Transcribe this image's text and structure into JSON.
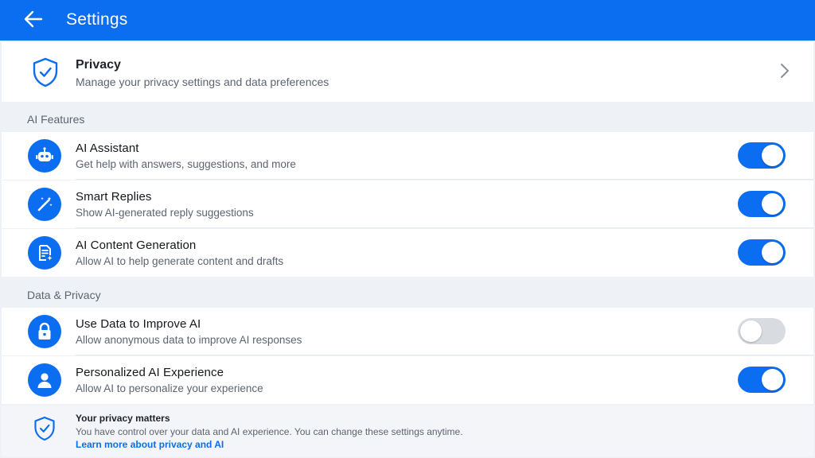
{
  "header": {
    "title": "Settings",
    "back_icon": "arrow-left-icon"
  },
  "privacy_card": {
    "icon": "shield-check-icon",
    "title": "Privacy",
    "subtitle": "Manage your privacy settings and data preferences",
    "chevron_icon": "chevron-right-icon"
  },
  "sections": {
    "ai_features": {
      "label": "AI Features",
      "items": [
        {
          "icon": "robot-icon",
          "title": "AI Assistant",
          "subtitle": "Get help with answers, suggestions, and more",
          "enabled": true
        },
        {
          "icon": "magic-wand-icon",
          "title": "Smart Replies",
          "subtitle": "Show AI-generated reply suggestions",
          "enabled": true
        },
        {
          "icon": "document-sparkle-icon",
          "title": "AI Content Generation",
          "subtitle": "Allow AI to help generate content and drafts",
          "enabled": true
        }
      ]
    },
    "data_privacy": {
      "label": "Data & Privacy",
      "items": [
        {
          "icon": "lock-icon",
          "title": "Use Data to Improve AI",
          "subtitle": "Allow anonymous data to improve AI responses",
          "enabled": false
        },
        {
          "icon": "person-icon",
          "title": "Personalized AI Experience",
          "subtitle": "Allow AI to personalize your experience",
          "enabled": true
        }
      ]
    }
  },
  "footer": {
    "icon": "shield-check-icon",
    "title": "Your privacy matters",
    "body": "You have control over your data and AI experience. You can change these settings anytime.",
    "link": "Learn more about privacy and AI"
  },
  "colors": {
    "accent": "#0b6df0",
    "toggle_off": "#d8dbe0",
    "background": "#eef1f6"
  }
}
